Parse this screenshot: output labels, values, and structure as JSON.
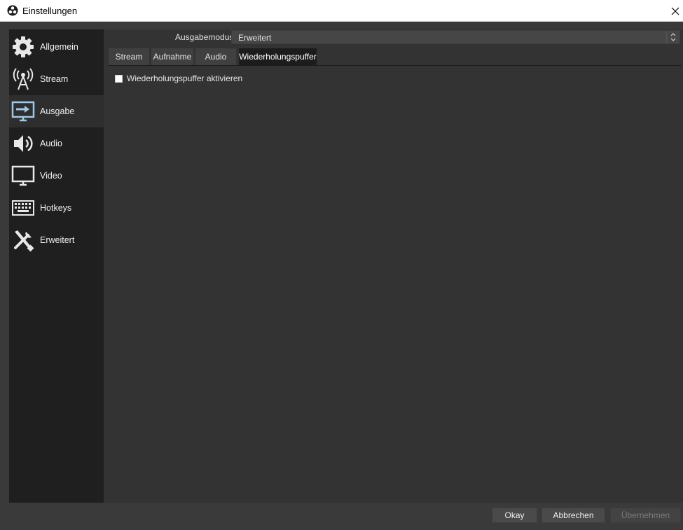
{
  "window": {
    "title": "Einstellungen"
  },
  "sidebar": {
    "items": [
      {
        "label": "Allgemein",
        "icon": "gear-icon"
      },
      {
        "label": "Stream",
        "icon": "broadcast-tower-icon"
      },
      {
        "label": "Ausgabe",
        "icon": "output-monitor-icon",
        "active": true
      },
      {
        "label": "Audio",
        "icon": "speaker-icon"
      },
      {
        "label": "Video",
        "icon": "monitor-icon"
      },
      {
        "label": "Hotkeys",
        "icon": "keyboard-icon"
      },
      {
        "label": "Erweitert",
        "icon": "tools-icon"
      }
    ]
  },
  "output": {
    "mode_label": "Ausgabemodus",
    "mode_value": "Erweitert",
    "tabs": [
      {
        "label": "Stream"
      },
      {
        "label": "Aufnahme"
      },
      {
        "label": "Audio"
      },
      {
        "label": "Wiederholungspuffer",
        "active": true
      }
    ],
    "replay_checkbox_label": "Wiederholungspuffer aktivieren",
    "replay_checked": false
  },
  "buttons": {
    "ok": "Okay",
    "cancel": "Abbrechen",
    "apply": "Übernehmen"
  },
  "colors": {
    "accent": "#9fc8e8"
  }
}
